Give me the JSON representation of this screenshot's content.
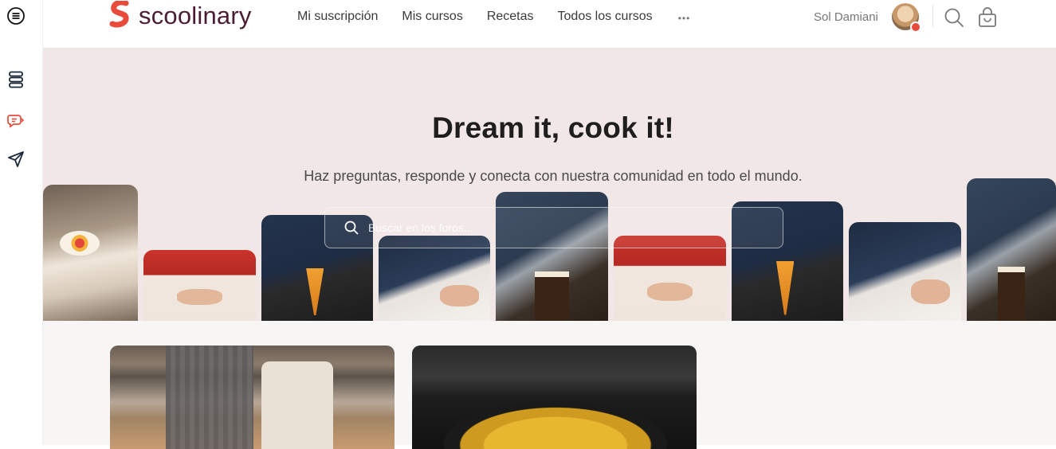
{
  "header": {
    "logo_text": "scoolinary",
    "nav": [
      {
        "label": "Mi suscripción"
      },
      {
        "label": "Mis cursos"
      },
      {
        "label": "Recetas"
      },
      {
        "label": "Todos los cursos"
      }
    ],
    "more_label": "•••",
    "user_name": "Sol Damiani"
  },
  "hero": {
    "title": "Dream it, cook it!",
    "subtitle": "Haz preguntas, responde y conecta con nuestra comunidad en todo el mundo.",
    "search_placeholder": "Buscar en los foros..."
  },
  "colors": {
    "brand_logo": "#e84a3b",
    "brand_text": "#4a1d34",
    "hero_bg": "#f1e7e6",
    "rail_icon": "#1c2a3a",
    "rail_icon_active": "#e84a3b"
  },
  "icons": {
    "rail": [
      "menu-icon",
      "layers-icon",
      "chat-icon",
      "send-icon"
    ],
    "header": [
      "search-icon",
      "shopping-bag-icon"
    ]
  }
}
